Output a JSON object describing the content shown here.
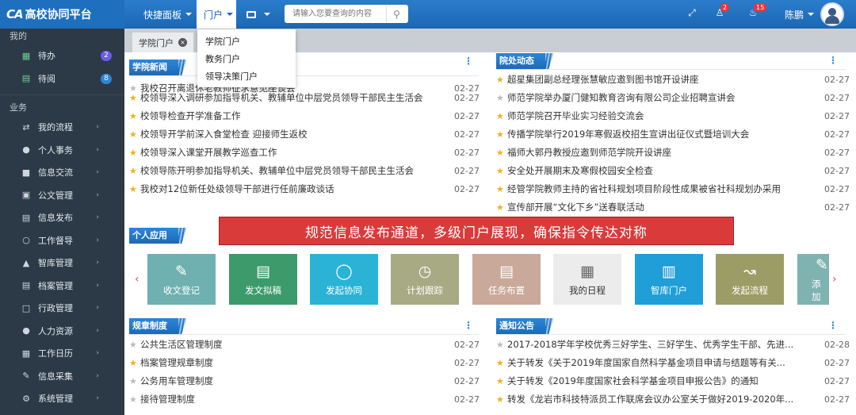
{
  "brand": {
    "logo": "CA",
    "name": "高校协同平台"
  },
  "topnav": {
    "quick_panel": "快捷面板",
    "portal": "门户"
  },
  "search": {
    "placeholder": "请输入您要查询的内容"
  },
  "badges": {
    "tasks": "2",
    "notices": "15"
  },
  "user": {
    "name": "陈鹏"
  },
  "dropdown": [
    "学院门户",
    "教务门户",
    "领导决策门户"
  ],
  "sidebar": {
    "groups": [
      "我的",
      "业务"
    ],
    "mine": [
      {
        "label": "待办",
        "count": "2",
        "icon": "grid-icon",
        "count_color": "#6c5ce7"
      },
      {
        "label": "待阅",
        "count": "8",
        "icon": "list-icon",
        "count_color": "#2d86d6"
      }
    ],
    "business": [
      {
        "label": "我的流程",
        "icon": "exchange-icon"
      },
      {
        "label": "个人事务",
        "icon": "user-icon"
      },
      {
        "label": "信息交流",
        "icon": "chat-icon"
      },
      {
        "label": "公文管理",
        "icon": "briefcase-icon"
      },
      {
        "label": "信息发布",
        "icon": "news-icon"
      },
      {
        "label": "工作督导",
        "icon": "bulb-icon"
      },
      {
        "label": "智库管理",
        "icon": "graduation-icon"
      },
      {
        "label": "档案管理",
        "icon": "archive-icon"
      },
      {
        "label": "行政管理",
        "icon": "edit-icon"
      },
      {
        "label": "人力资源",
        "icon": "group-icon"
      },
      {
        "label": "工作日历",
        "icon": "calendar-icon"
      },
      {
        "label": "信息采集",
        "icon": "pencil-icon"
      },
      {
        "label": "系统管理",
        "icon": "gear-icon"
      }
    ]
  },
  "tab": {
    "label": "学院门户"
  },
  "college_news": {
    "title": "学院新闻",
    "items": [
      {
        "text": "我校召开离退休老教师征求意见座谈会",
        "date": "02-27"
      },
      {
        "text": "校领导深入调研参加指导机关、教辅单位中层党员领导干部民主生活会",
        "date": "02-27"
      },
      {
        "text": "校领导检查开学准备工作",
        "date": "02-27"
      },
      {
        "text": "校领导开学前深入食堂检查 迎接师生返校",
        "date": "02-27"
      },
      {
        "text": "校领导深入课堂开展教学巡查工作",
        "date": "02-27"
      },
      {
        "text": "校领导陈开明参加指导机关、教辅单位中层党员领导干部民主生活会",
        "date": "02-27"
      },
      {
        "text": "我校对12位新任处级领导干部进行任前廉政谈话",
        "date": "02-27"
      }
    ]
  },
  "dept_news": {
    "title": "院处动态",
    "items": [
      {
        "text": "超星集团副总经理张慧敏应邀到图书馆开设讲座",
        "date": "02-27"
      },
      {
        "text": "师范学院举办厦门健知教育咨询有限公司企业招聘宣讲会",
        "date": "02-27"
      },
      {
        "text": "师范学院召开毕业实习经验交流会",
        "date": "02-27"
      },
      {
        "text": "传播学院举行2019年寒假返校招生宣讲出征仪式暨培训大会",
        "date": "02-27"
      },
      {
        "text": "福师大郭丹教授应邀到师范学院开设讲座",
        "date": "02-27"
      },
      {
        "text": "安全处开展期末及寒假校园安全检查",
        "date": "02-27"
      },
      {
        "text": "经管学院教师主持的省社科规划项目阶段性成果被省社科规划办采用",
        "date": "02-27"
      },
      {
        "text": "宣传部开展“文化下乡”送春联活动",
        "date": "02-27"
      }
    ]
  },
  "banner": {
    "text": "规范信息发布通道，多级门户展现，确保指令传达对称"
  },
  "personal_apps": {
    "title": "个人应用",
    "items": [
      {
        "label": "收文登记",
        "icon": "edit-doc-icon",
        "color": "#6fb1b0"
      },
      {
        "label": "发文拟稿",
        "icon": "document-icon",
        "color": "#3c9a6b"
      },
      {
        "label": "发起协同",
        "icon": "chat-bubble-icon",
        "color": "#2bb3d6"
      },
      {
        "label": "计划跟踪",
        "icon": "clock-doc-icon",
        "color": "#a8aa84"
      },
      {
        "label": "任务布置",
        "icon": "task-icon",
        "color": "#c9a99a"
      },
      {
        "label": "我的日程",
        "icon": "calendar-icon",
        "color": "#ececec"
      },
      {
        "label": "智库门户",
        "icon": "book-icon",
        "color": "#1f9ed8"
      },
      {
        "label": "发起流程",
        "icon": "flow-icon",
        "color": "#9c9c66"
      },
      {
        "label": "添加",
        "icon": "add-icon",
        "color": "#7fb3b1"
      }
    ]
  },
  "rules": {
    "title": "规章制度",
    "items": [
      {
        "text": "公共生活区管理制度",
        "date": "02-27"
      },
      {
        "text": "档案管理规章制度",
        "date": "02-27"
      },
      {
        "text": "公务用车管理制度",
        "date": "02-27"
      },
      {
        "text": "接待管理制度",
        "date": "02-27"
      }
    ]
  },
  "notices": {
    "title": "通知公告",
    "items": [
      {
        "text": "2017-2018学年学校优秀三好学生、三好学生、优秀学生干部、先进...",
        "date": "02-28"
      },
      {
        "text": "关于转发《关于2019年度国家自然科学基金项目申请与结题等有关...",
        "date": "02-27"
      },
      {
        "text": "关于转发《2019年度国家社会科学基金项目申报公告》的通知",
        "date": "02-27"
      },
      {
        "text": "转发《龙岩市科技特派员工作联席会议办公室关于做好2019-2020年...",
        "date": "02-27"
      }
    ]
  },
  "colors": {
    "accent": "#1c67b3",
    "sidebar": "#2c3a47",
    "star": "#f2b01e",
    "banner": "#d93b3b"
  }
}
